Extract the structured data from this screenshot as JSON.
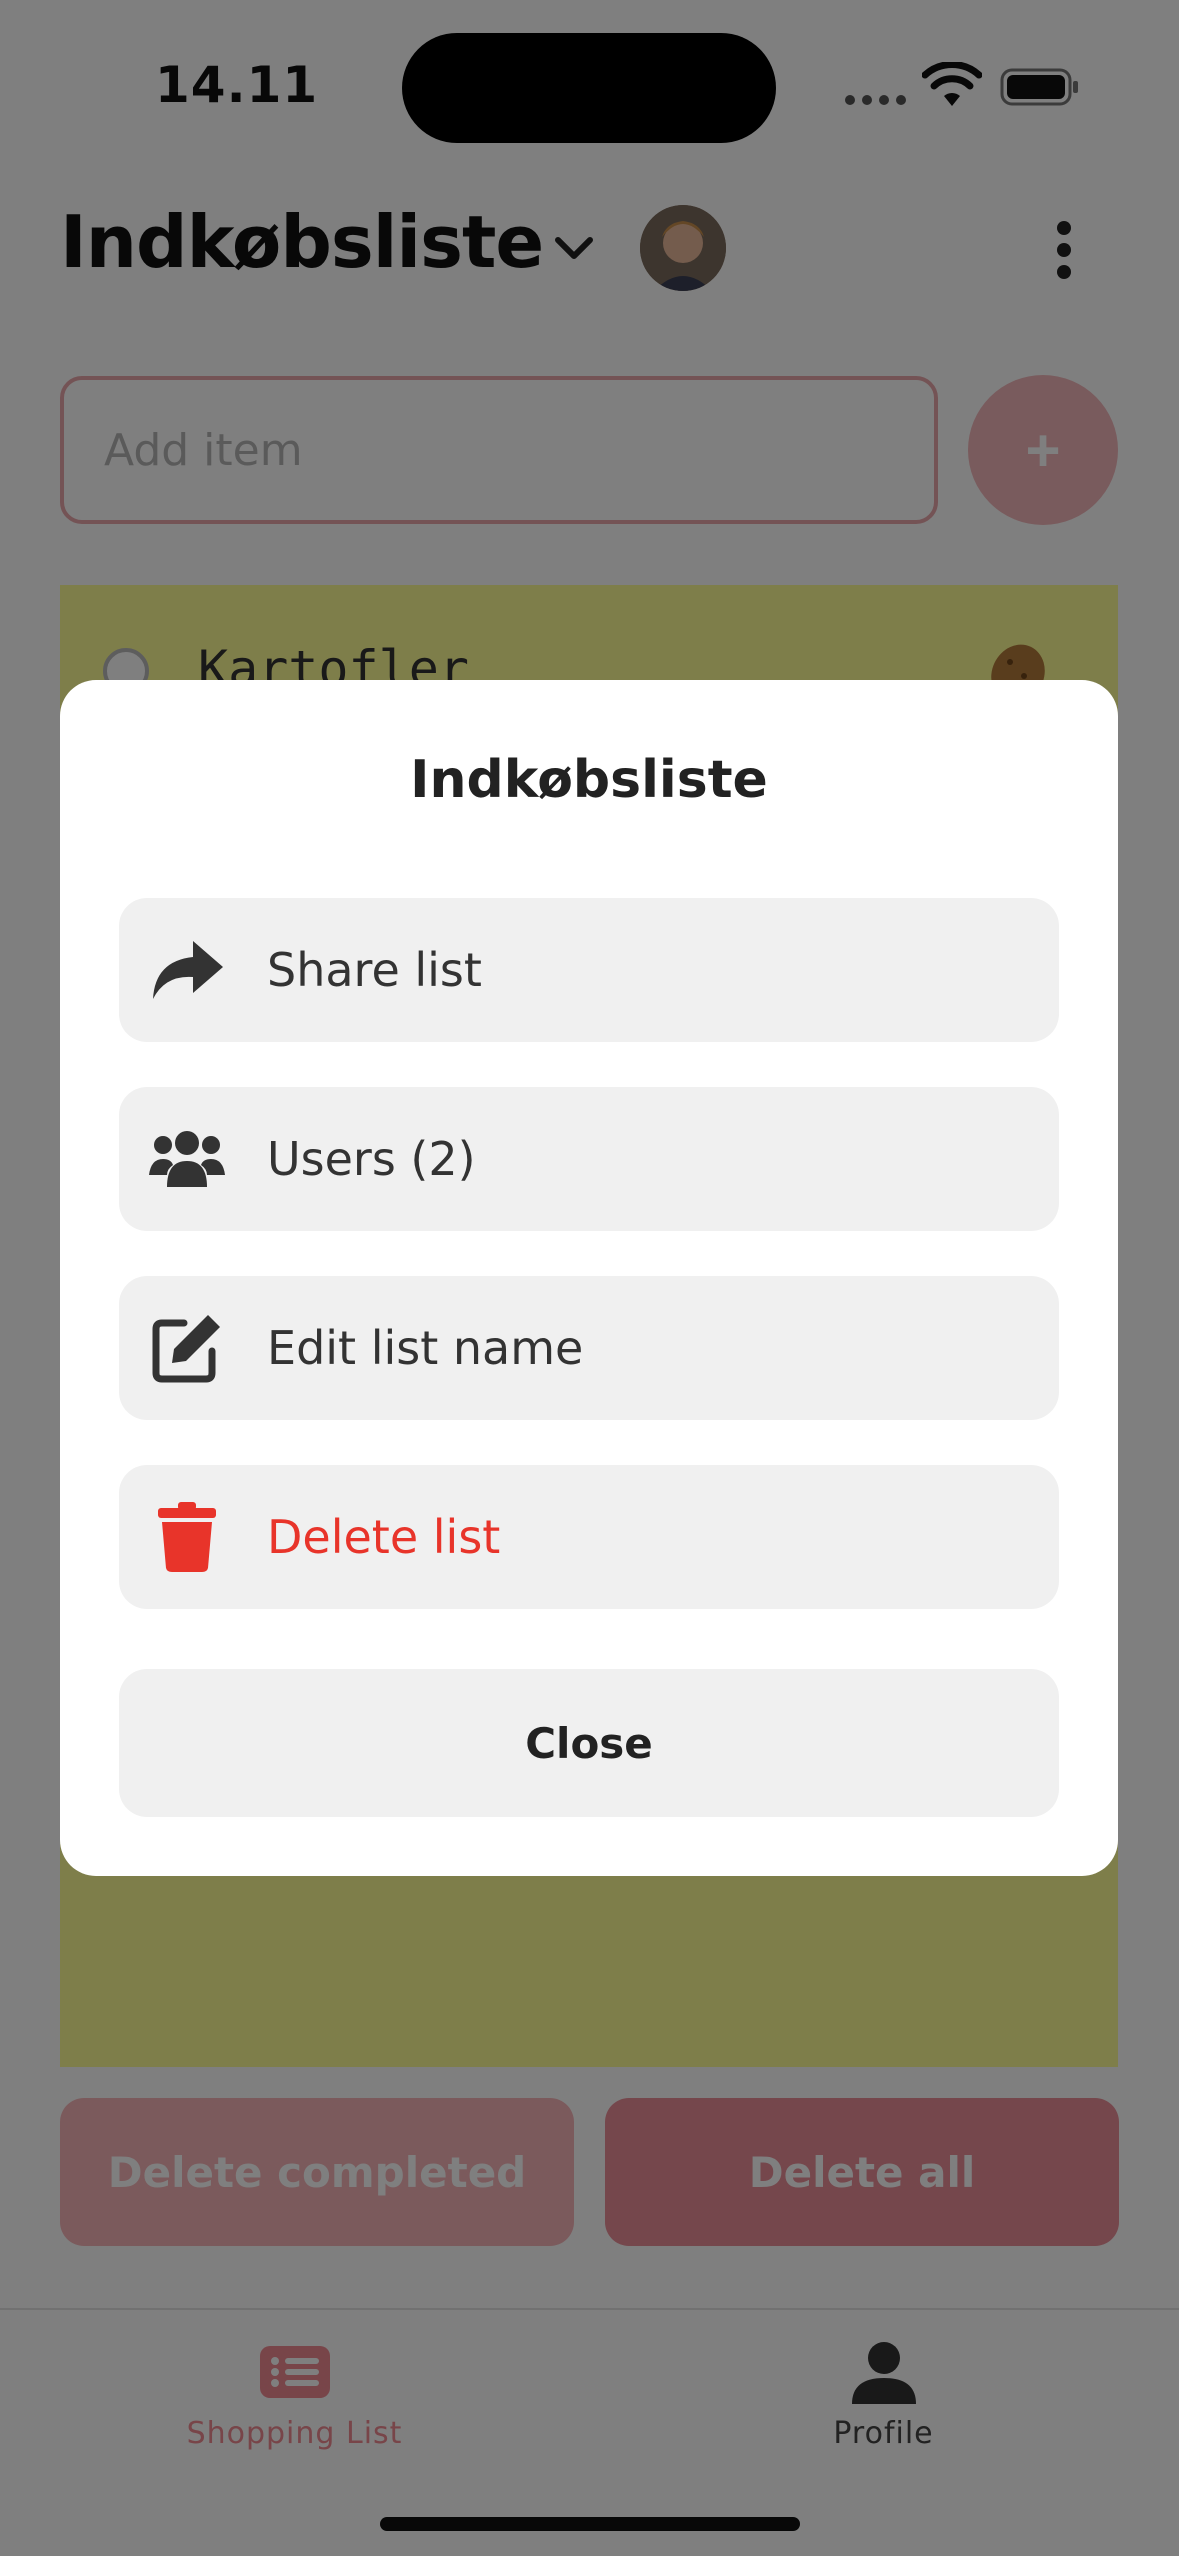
{
  "status_bar": {
    "time": "14.11"
  },
  "header": {
    "title": "Indkøbsliste"
  },
  "add_item": {
    "placeholder": "Add item",
    "button_label": "+"
  },
  "items": [
    {
      "name": "Kartofler",
      "icon": "potato-icon"
    }
  ],
  "actions": {
    "delete_completed": "Delete completed",
    "delete_all": "Delete all"
  },
  "tabs": [
    {
      "label": "Shopping List",
      "icon": "list-icon",
      "active": true
    },
    {
      "label": "Profile",
      "icon": "person-icon",
      "active": false
    }
  ],
  "modal": {
    "title": "Indkøbsliste",
    "items": [
      {
        "label": "Share list",
        "icon": "share-icon"
      },
      {
        "label": "Users (2)",
        "icon": "users-icon"
      },
      {
        "label": "Edit list name",
        "icon": "edit-icon"
      },
      {
        "label": "Delete list",
        "icon": "trash-icon",
        "color": "#e8342a"
      }
    ],
    "close_label": "Close"
  },
  "colors": {
    "accent": "#f08a92",
    "list_background": "#fcfc94",
    "danger": "#e8342a",
    "scrim": "rgba(0,0,0,0.5)"
  }
}
